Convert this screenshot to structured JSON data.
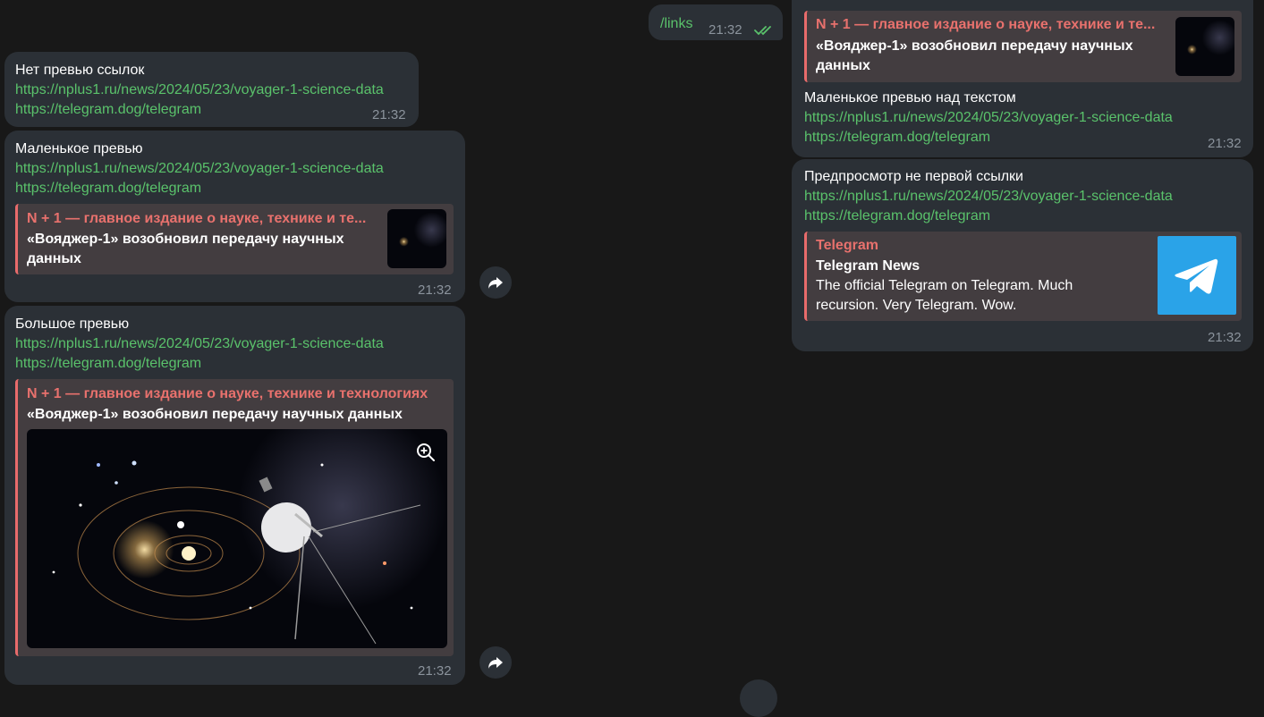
{
  "links_cmd": {
    "text": "/links",
    "time": "21:32"
  },
  "msg_no_preview": {
    "title": "Нет превью ссылок",
    "link1": "https://nplus1.ru/news/2024/05/23/voyager-1-science-data",
    "link2": "https://telegram.dog/telegram",
    "time": "21:32"
  },
  "msg_small": {
    "title": "Маленькое превью",
    "link1": "https://nplus1.ru/news/2024/05/23/voyager-1-science-data",
    "link2": "https://telegram.dog/telegram",
    "preview_site": "N + 1 — главное издание о науке, технике и те...",
    "preview_title": "«Вояджер-1» возобновил передачу научных данных",
    "time": "21:32"
  },
  "msg_large": {
    "title": "Большое превью",
    "link1": "https://nplus1.ru/news/2024/05/23/voyager-1-science-data",
    "link2": "https://telegram.dog/telegram",
    "preview_site": "N + 1 — главное издание о науке, технике и технологиях",
    "preview_title": "«Вояджер-1» возобновил передачу научных данных",
    "time": "21:32"
  },
  "msg_small_above": {
    "preview_site": "N + 1 — главное издание о науке, технике и те...",
    "preview_title": "«Вояджер-1» возобновил передачу научных данных",
    "title": "Маленькое превью над текстом",
    "link1": "https://nplus1.ru/news/2024/05/23/voyager-1-science-data",
    "link2": "https://telegram.dog/telegram",
    "time": "21:32"
  },
  "msg_not_first": {
    "title": "Предпросмотр не первой ссылки",
    "link1": "https://nplus1.ru/news/2024/05/23/voyager-1-science-data",
    "link2": "https://telegram.dog/telegram",
    "preview_site": "Telegram",
    "preview_title": "Telegram News",
    "preview_desc": "The official Telegram on Telegram. Much recursion. Very Telegram. Wow.",
    "time": "21:32"
  },
  "colors": {
    "background": "#181818",
    "bubble": "#2b3036",
    "link": "#5ac26b",
    "preview_accent": "#e8716d",
    "preview_bg": "#433d40",
    "telegram_blue": "#2aa3e8"
  },
  "icons": [
    "double-check-icon",
    "share-icon",
    "zoom-in-icon",
    "telegram-logo-icon"
  ]
}
